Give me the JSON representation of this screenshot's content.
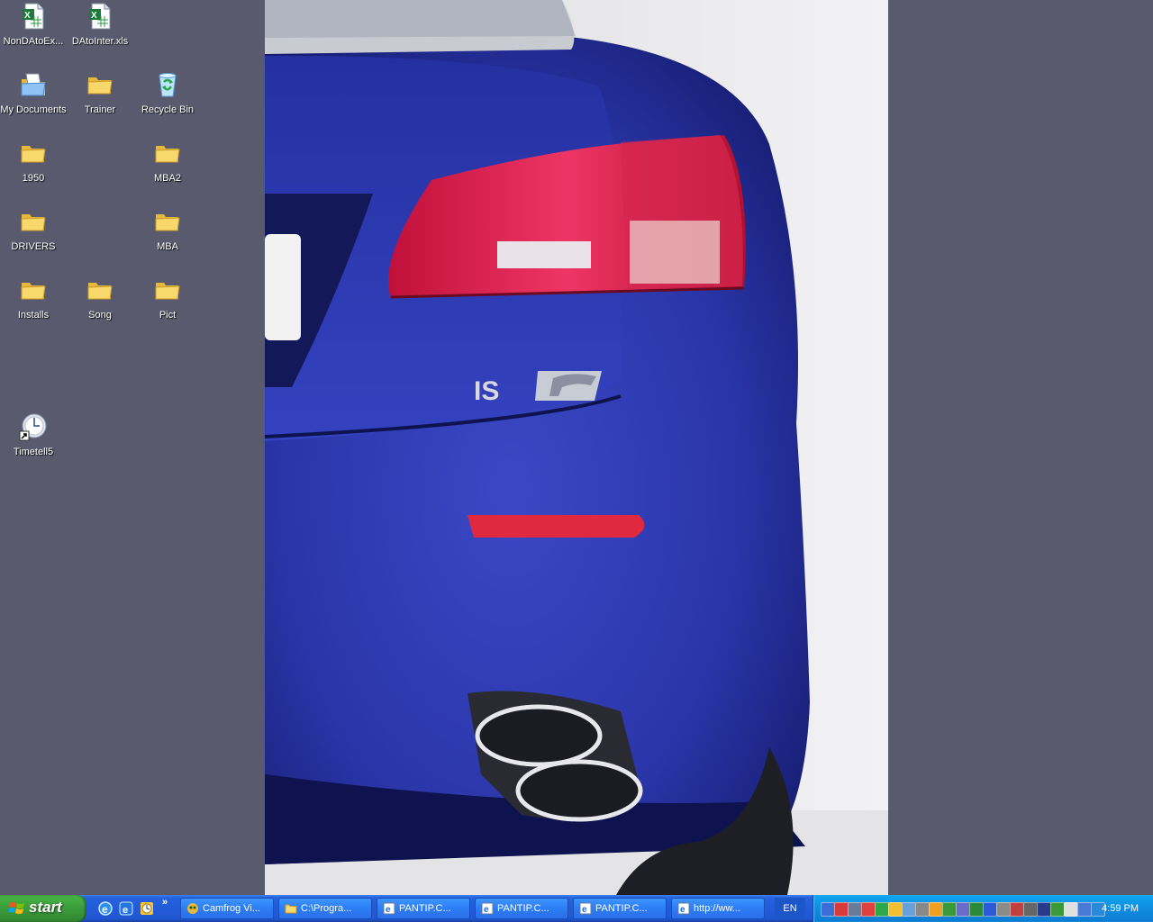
{
  "desktop": {
    "icons": [
      {
        "label": "NonDAtoEx...",
        "type": "excel"
      },
      {
        "label": "DAtoInter.xls",
        "type": "excel"
      },
      {
        "label": "My Documents",
        "type": "mydocs"
      },
      {
        "label": "Trainer",
        "type": "folder"
      },
      {
        "label": "Recycle Bin",
        "type": "recycle"
      },
      {
        "label": "1950",
        "type": "folder"
      },
      {
        "label": "MBA2",
        "type": "folder"
      },
      {
        "label": "DRIVERS",
        "type": "folder"
      },
      {
        "label": "MBA",
        "type": "folder"
      },
      {
        "label": "Installs",
        "type": "folder"
      },
      {
        "label": "Song",
        "type": "folder"
      },
      {
        "label": "Pict",
        "type": "folder"
      },
      {
        "label": "Timetell5",
        "type": "shortcut-clock"
      }
    ],
    "wallpaper": {
      "badge_text": "IS",
      "car_color": "#2a35a8",
      "light_color": "#e0204a"
    }
  },
  "taskbar": {
    "start_label": "start",
    "quick_launch": [
      "ie-icon",
      "browser-icon",
      "clock-icon"
    ],
    "more_label": "»",
    "tasks": [
      {
        "label": "Camfrog Vi...",
        "icon": "camfrog-icon"
      },
      {
        "label": "C:\\Progra...",
        "icon": "folder-icon"
      },
      {
        "label": "PANTIP.C...",
        "icon": "ie-icon"
      },
      {
        "label": "PANTIP.C...",
        "icon": "ie-icon"
      },
      {
        "label": "PANTIP.C...",
        "icon": "ie-icon"
      },
      {
        "label": "http://ww...",
        "icon": "ie-icon"
      }
    ],
    "language": "EN",
    "tray_icon_count": 21,
    "clock": "4:59 PM"
  }
}
